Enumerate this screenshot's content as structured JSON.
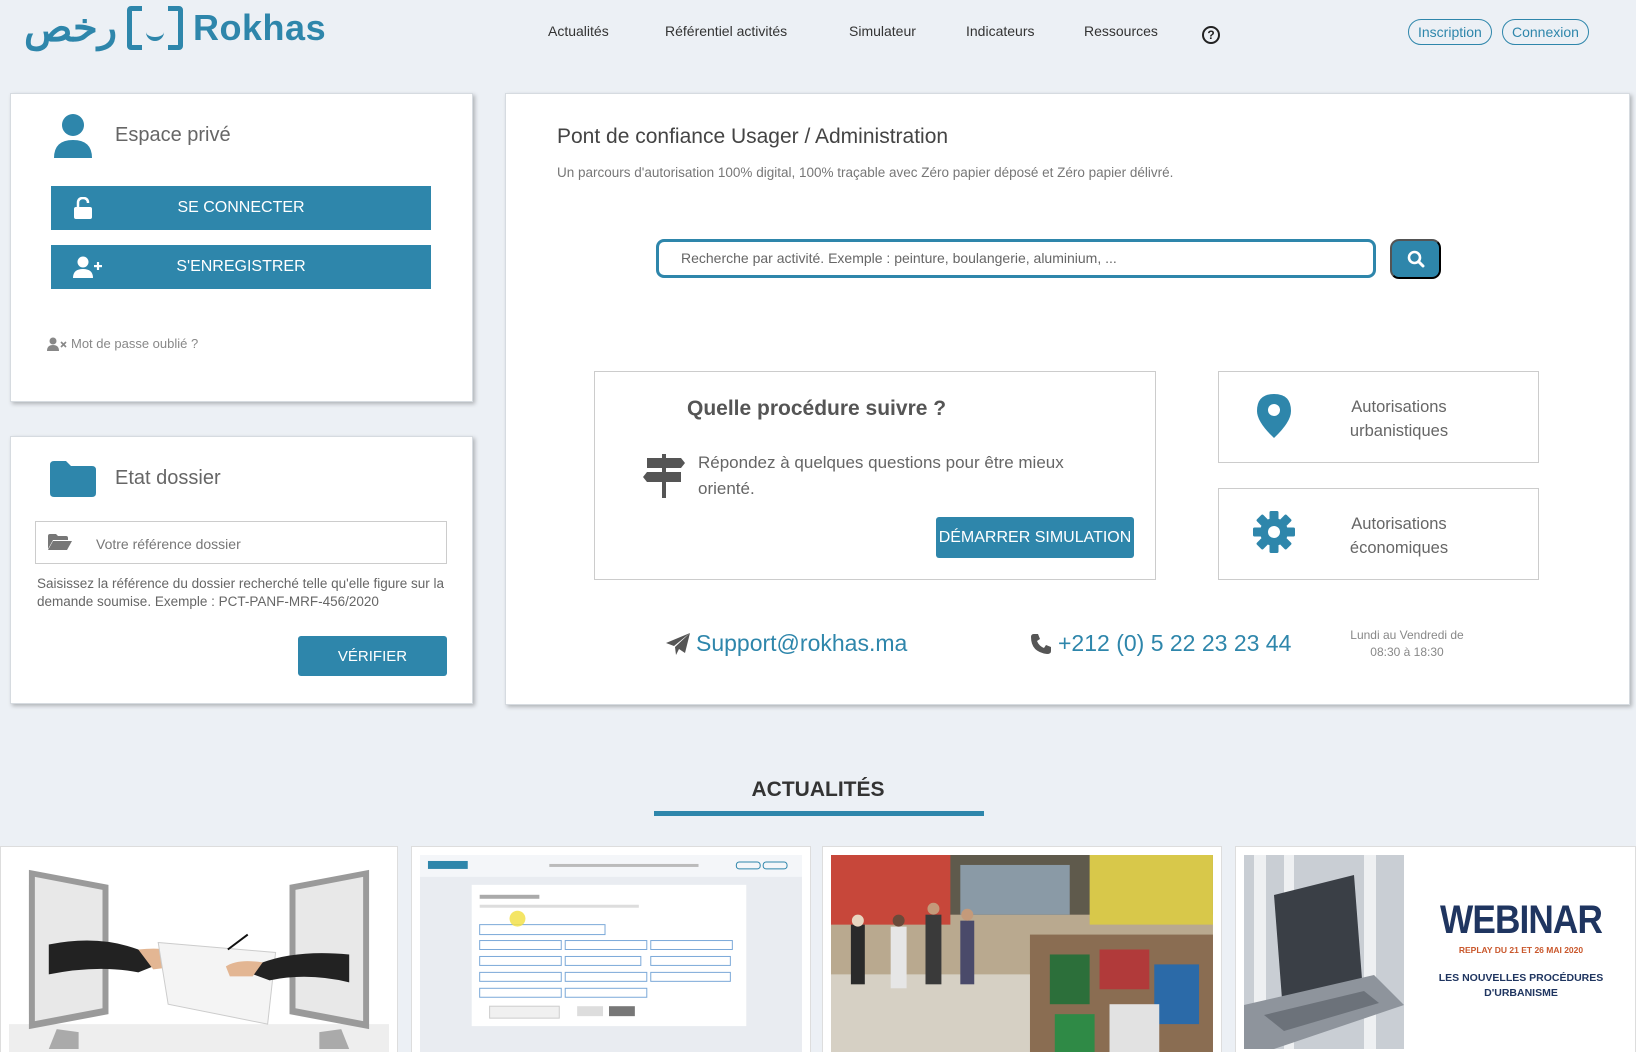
{
  "header": {
    "logo_arabic": "رخص",
    "logo_text": "Rokhas",
    "nav": [
      "Actualités",
      "Référentiel activités",
      "Simulateur",
      "Indicateurs",
      "Ressources"
    ],
    "help_label": "?",
    "inscription": "Inscription",
    "connexion": "Connexion"
  },
  "espace_prive": {
    "title": "Espace privé",
    "login_button": "SE CONNECTER",
    "register_button": "S'ENREGISTRER",
    "forgot_password": "Mot de passe oublié ?"
  },
  "etat_dossier": {
    "title": "Etat dossier",
    "ref_placeholder": "Votre référence dossier",
    "help_text": "Saisissez la référence du dossier recherché telle qu'elle figure sur la demande soumise. Exemple : PCT-PANF-MRF-456/2020",
    "verify_button": "VÉRIFIER"
  },
  "main": {
    "title": "Pont de confiance Usager / Administration",
    "subtitle": "Un parcours d'autorisation 100% digital, 100% traçable avec Zéro papier déposé et Zéro papier délivré.",
    "search_placeholder": "Recherche par activité. Exemple : peinture, boulangerie, aluminium, ...",
    "procedure": {
      "title": "Quelle procédure suivre ?",
      "text": "Répondez à quelques questions pour être mieux orienté.",
      "button": "DÉMARRER SIMULATION"
    },
    "auth_urbanistiques": "Autorisations urbanistiques",
    "auth_economiques": "Autorisations économiques",
    "support_email": "Support@rokhas.ma",
    "support_phone": "+212 (0) 5 22 23 23 44",
    "hours_line1": "Lundi au Vendredi de",
    "hours_line2": "08:30 à 18:30"
  },
  "news": {
    "section_title": "ACTUALITÉS",
    "webinar_title": "WEBINAR",
    "webinar_replay": "REPLAY DU 21 ET 26 MAI 2020",
    "webinar_topic_1": "LES NOUVELLES PROCÉDURES",
    "webinar_topic_2": "D'URBANISME"
  },
  "colors": {
    "brand": "#2e86ab",
    "background": "#ecf0f5"
  }
}
